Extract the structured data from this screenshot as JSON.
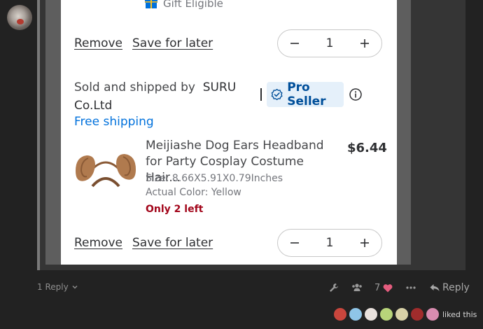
{
  "post": {
    "avatar_icon": "user-avatar",
    "replies_label": "1 Reply",
    "like_count": "7",
    "reply_label": "Reply",
    "liked_text": "liked this",
    "likers": [
      {
        "name": "liker-1",
        "color": "#c9463d"
      },
      {
        "name": "liker-2",
        "color": "#8fc5e8"
      },
      {
        "name": "liker-3",
        "color": "#e9e1dd"
      },
      {
        "name": "liker-4",
        "color": "#b8d47a"
      },
      {
        "name": "liker-5",
        "color": "#d9d2a8"
      },
      {
        "name": "liker-6",
        "color": "#a12c2c"
      },
      {
        "name": "liker-7",
        "color": "#d98cb0"
      }
    ]
  },
  "cart": {
    "gift_label": "Gift Eligible",
    "item1": {
      "remove_label": "Remove",
      "save_label": "Save for later",
      "quantity": "1"
    },
    "seller": {
      "prefix": "Sold and shipped by",
      "name": "SURU Co.Ltd",
      "badge": "Pro Seller",
      "shipping": "Free shipping"
    },
    "item2": {
      "title": "Meijiashe Dog Ears Headband for Party Cosplay Costume Hair...",
      "price": "$6.44",
      "size": "Size: 8.66X5.91X0.79Inches",
      "color": "Actual Color: Yellow",
      "stock": "Only 2 left",
      "remove_label": "Remove",
      "save_label": "Save for later",
      "quantity": "1"
    }
  },
  "colors": {
    "link_blue": "#0071dc",
    "pro_badge_bg": "#e5f0fa",
    "pro_badge_text": "#004f9a",
    "low_stock_red": "#a2051a",
    "like_heart": "#e45c7e"
  }
}
